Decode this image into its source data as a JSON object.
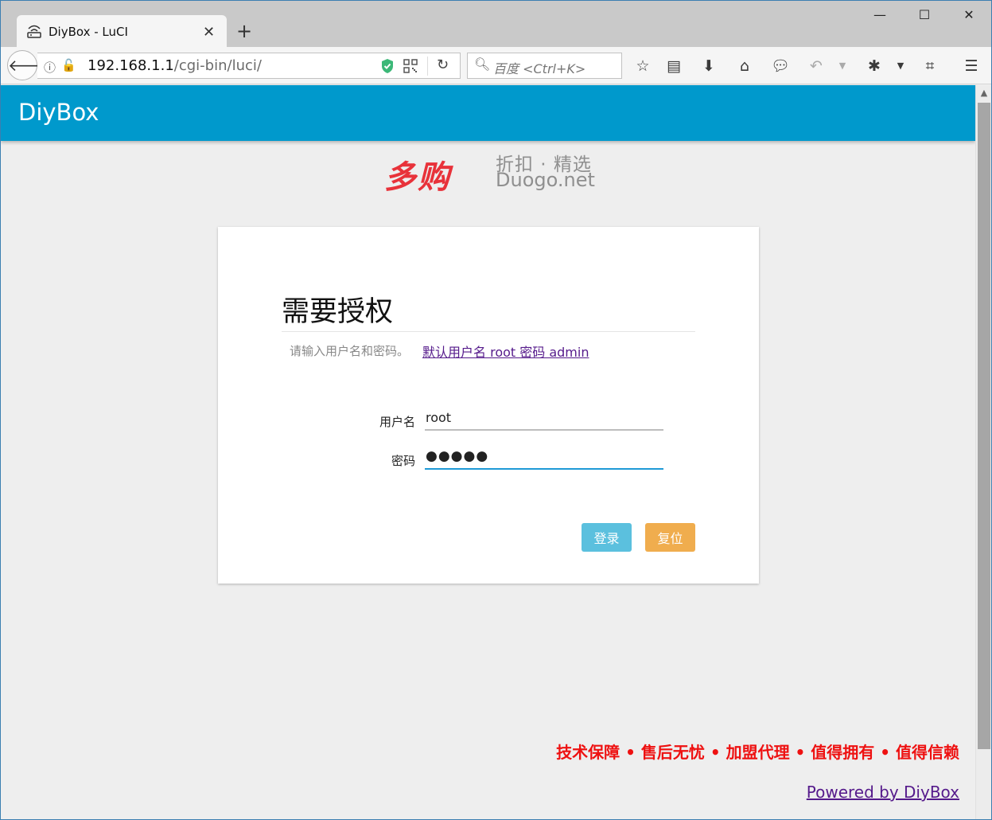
{
  "browser": {
    "tab_title": "DiyBox - LuCI",
    "url_host": "192.168.1.1",
    "url_path": "/cgi-bin/luci/",
    "search_placeholder": "百度 <Ctrl+K>"
  },
  "header": {
    "brand": "DiyBox"
  },
  "watermark": {
    "logo": "多购",
    "tagline": "折扣 · 精选",
    "domain": "Duogo.net"
  },
  "login": {
    "title": "需要授权",
    "description": "请输入用户名和密码。",
    "hint_link": "默认用户名 root 密码 admin",
    "username_label": "用户名",
    "username_value": "root",
    "password_label": "密码",
    "password_value": "●●●●●",
    "login_button": "登录",
    "reset_button": "复位"
  },
  "footer": {
    "slogan": "技术保障 • 售后无忧 • 加盟代理 • 值得拥有 • 值得信赖",
    "powered_by": "Powered by DiyBox"
  },
  "colors": {
    "header": "#0099cc",
    "login_button": "#5bc0de",
    "reset_button": "#f0ad4e",
    "slogan": "#ee1111"
  }
}
